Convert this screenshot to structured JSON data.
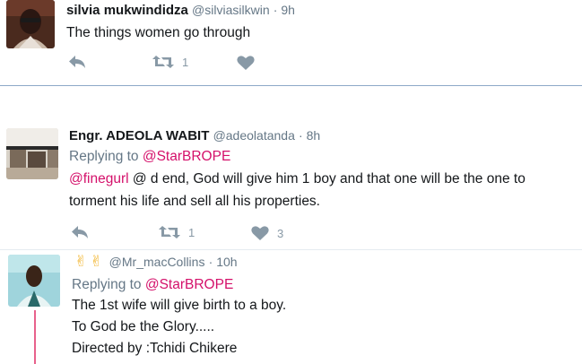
{
  "colors": {
    "mention": "#d4106a",
    "muted": "#657786",
    "icon": "#8899a6",
    "thread_line": "#e8618c",
    "separator": "#8da8c8"
  },
  "tweets": [
    {
      "name": "silvia mukwindidza",
      "handle": "@silviasilkwin",
      "time": "· 9h",
      "text": "The things women go through",
      "retweets": "1",
      "likes": ""
    },
    {
      "name": "Engr. ADEOLA WABIT",
      "handle": "@adeolatanda",
      "time": "· 8h",
      "replying_prefix": "Replying to ",
      "replying_to": "@StarBROPE",
      "mention": "@finegurl",
      "text_line1_rest": " @ d end, God will give him 1 boy and that one will be the one to",
      "text_line2": "torment his life and sell all his properties.",
      "retweets": "1",
      "likes": "3"
    },
    {
      "name_emoji": "✌✌",
      "handle": "@Mr_macCollins",
      "time": "· 10h",
      "replying_prefix": "Replying to ",
      "replying_to": "@StarBROPE",
      "lines": [
        "The 1st wife will give birth to a boy.",
        "To God be the Glory.....",
        "Directed by :Tchidi Chikere"
      ]
    }
  ]
}
